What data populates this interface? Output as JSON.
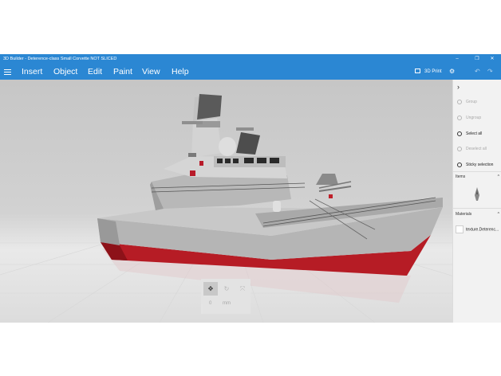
{
  "window": {
    "title": "3D Builder - Deterence-class Small Corvette NOT SLICED"
  },
  "titlebar": {
    "controls": [
      {
        "name": "minimize-button",
        "glyph": "–"
      },
      {
        "name": "maximize-button",
        "glyph": "❐"
      },
      {
        "name": "close-button",
        "glyph": "✕"
      }
    ]
  },
  "menu": {
    "items": [
      "Insert",
      "Object",
      "Edit",
      "Paint",
      "View",
      "Help"
    ],
    "print_label": "3D Print",
    "icons": [
      "hamburger-icon",
      "printer-icon",
      "settings-icon",
      "undo-icon",
      "redo-icon"
    ]
  },
  "panel": {
    "collapse_glyph": "›",
    "actions": [
      {
        "label": "Group",
        "icon": "group-icon",
        "enabled": false
      },
      {
        "label": "Ungroup",
        "icon": "ungroup-icon",
        "enabled": false
      },
      {
        "label": "Select all",
        "icon": "select-all-icon",
        "enabled": true
      },
      {
        "label": "Deselect all",
        "icon": "deselect-all-icon",
        "enabled": false
      },
      {
        "label": "Sticky selection",
        "icon": "sticky-selection-icon",
        "enabled": true
      }
    ],
    "items_title": "Items",
    "materials_title": "Materials",
    "material": {
      "label": "texture.Deterenc..."
    },
    "chevron": "^"
  },
  "floating_toolbar": {
    "value": "0",
    "unit": "mm",
    "tools": [
      "move-icon",
      "rotate-icon",
      "scale-icon"
    ]
  },
  "colors": {
    "accent": "#2b87d3",
    "hull_lower": "#c0202a",
    "hull_upper": "#b8b8b8",
    "panel_bg": "#f2f2f2"
  }
}
